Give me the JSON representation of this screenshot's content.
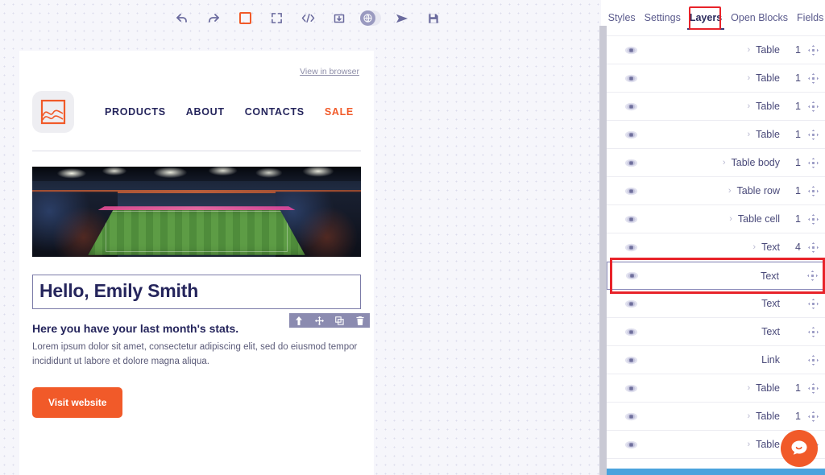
{
  "toolbar": {
    "icons": [
      {
        "name": "undo-icon",
        "label": "Undo"
      },
      {
        "name": "redo-icon",
        "label": "Redo"
      },
      {
        "name": "borders-toggle-icon",
        "label": "Toggle borders"
      },
      {
        "name": "fullscreen-icon",
        "label": "Fullscreen"
      },
      {
        "name": "code-view-icon",
        "label": "View code"
      },
      {
        "name": "import-icon",
        "label": "Import"
      },
      {
        "name": "device-toggle-icon",
        "label": "Device toggle"
      },
      {
        "name": "send-test-icon",
        "label": "Send test"
      },
      {
        "name": "save-icon",
        "label": "Save"
      }
    ]
  },
  "email": {
    "view_in_browser": "View in browser",
    "logo_alt": "logo",
    "nav": [
      {
        "label": "PRODUCTS",
        "accent": false
      },
      {
        "label": "ABOUT",
        "accent": false
      },
      {
        "label": "CONTACTS",
        "accent": false
      },
      {
        "label": "SALE",
        "accent": true
      }
    ],
    "hero_alt": "Football stadium at night",
    "headline": "Hello, Emily Smith",
    "subhead": "Here you have your last month's stats.",
    "paragraph": "Lorem ipsum dolor sit amet, consectetur adipiscing elit, sed do eiusmod tempor incididunt ut labore et dolore magna aliqua.",
    "cta_label": "Visit website",
    "selection_toolbar": [
      {
        "name": "move-up-icon",
        "label": "Move up"
      },
      {
        "name": "drag-move-icon",
        "label": "Move"
      },
      {
        "name": "duplicate-icon",
        "label": "Duplicate"
      },
      {
        "name": "delete-icon",
        "label": "Delete"
      }
    ]
  },
  "panel": {
    "tabs": [
      {
        "label": "Styles",
        "active": false
      },
      {
        "label": "Settings",
        "active": false
      },
      {
        "label": "Layers",
        "active": true
      },
      {
        "label": "Open Blocks",
        "active": false
      },
      {
        "label": "Fields",
        "active": false
      }
    ],
    "layers": [
      {
        "label": "Table",
        "indent": 5,
        "caret": true,
        "count": "1",
        "selected": false
      },
      {
        "label": "Table",
        "indent": 5,
        "caret": true,
        "count": "1",
        "selected": false
      },
      {
        "label": "Table",
        "indent": 5,
        "caret": true,
        "count": "1",
        "selected": false
      },
      {
        "label": "Table",
        "indent": 5,
        "caret": true,
        "count": "1",
        "selected": false
      },
      {
        "label": "Table body",
        "indent": 6,
        "caret": true,
        "count": "1",
        "selected": false
      },
      {
        "label": "Table row",
        "indent": 7,
        "caret": true,
        "count": "1",
        "selected": false
      },
      {
        "label": "Table cell",
        "indent": 8,
        "caret": true,
        "count": "1",
        "selected": false
      },
      {
        "label": "Text",
        "indent": 9,
        "caret": true,
        "count": "4",
        "selected": false
      },
      {
        "label": "Text",
        "indent": 10,
        "caret": false,
        "count": "",
        "selected": true
      },
      {
        "label": "Text",
        "indent": 10,
        "caret": false,
        "count": "",
        "selected": false
      },
      {
        "label": "Text",
        "indent": 10,
        "caret": false,
        "count": "",
        "selected": false
      },
      {
        "label": "Link",
        "indent": 10,
        "caret": false,
        "count": "",
        "selected": false
      },
      {
        "label": "Table",
        "indent": 5,
        "caret": true,
        "count": "1",
        "selected": false
      },
      {
        "label": "Table",
        "indent": 5,
        "caret": true,
        "count": "1",
        "selected": false
      },
      {
        "label": "Table",
        "indent": 5,
        "caret": true,
        "count": "1",
        "selected": false
      }
    ],
    "visibility_icon": "eye-icon",
    "move_icon": "move-handle-icon"
  },
  "chat": {
    "icon": "chat-bubble-icon",
    "label": "Open chat"
  },
  "colors": {
    "accent_orange": "#f15a29",
    "annotation_red": "#e8232a",
    "text_navy": "#25255c",
    "panel_text": "#4a4a7a",
    "scrollbar_blue": "#4aa3dd"
  }
}
